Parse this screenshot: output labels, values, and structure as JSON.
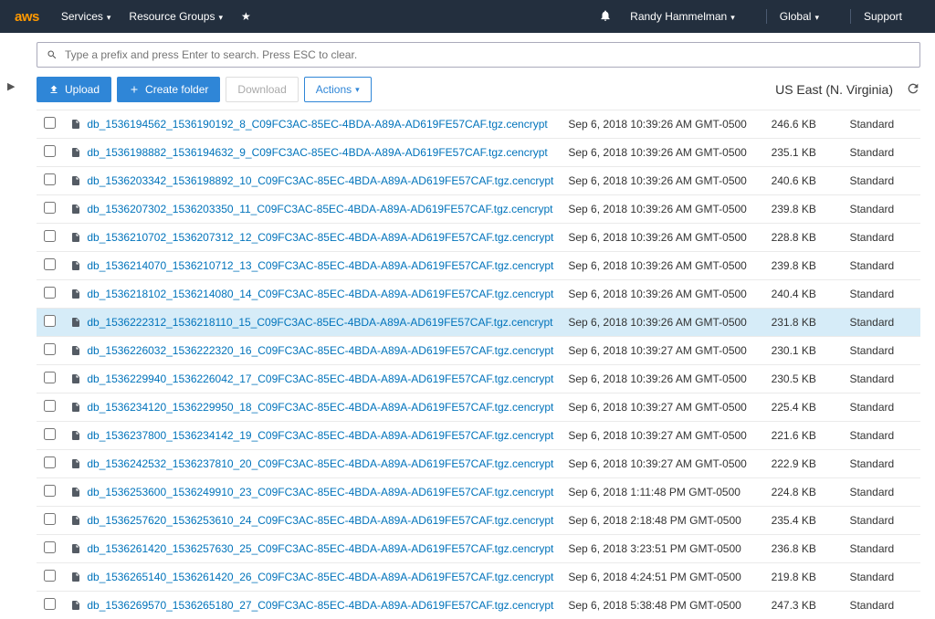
{
  "header": {
    "logo": "aws",
    "services": "Services",
    "resource_groups": "Resource Groups",
    "user": "Randy Hammelman",
    "global": "Global",
    "support": "Support"
  },
  "search": {
    "placeholder": "Type a prefix and press Enter to search. Press ESC to clear."
  },
  "toolbar": {
    "upload": "Upload",
    "create_folder": "Create folder",
    "download": "Download",
    "actions": "Actions"
  },
  "region": "US East (N. Virginia)",
  "storage_class": "Standard",
  "files": [
    {
      "name": "db_1536194562_1536190192_8_C09FC3AC-85EC-4BDA-A89A-AD619FE57CAF.tgz.cencrypt",
      "modified": "Sep 6, 2018 10:39:26 AM GMT-0500",
      "size": "246.6 KB"
    },
    {
      "name": "db_1536198882_1536194632_9_C09FC3AC-85EC-4BDA-A89A-AD619FE57CAF.tgz.cencrypt",
      "modified": "Sep 6, 2018 10:39:26 AM GMT-0500",
      "size": "235.1 KB"
    },
    {
      "name": "db_1536203342_1536198892_10_C09FC3AC-85EC-4BDA-A89A-AD619FE57CAF.tgz.cencrypt",
      "modified": "Sep 6, 2018 10:39:26 AM GMT-0500",
      "size": "240.6 KB"
    },
    {
      "name": "db_1536207302_1536203350_11_C09FC3AC-85EC-4BDA-A89A-AD619FE57CAF.tgz.cencrypt",
      "modified": "Sep 6, 2018 10:39:26 AM GMT-0500",
      "size": "239.8 KB"
    },
    {
      "name": "db_1536210702_1536207312_12_C09FC3AC-85EC-4BDA-A89A-AD619FE57CAF.tgz.cencrypt",
      "modified": "Sep 6, 2018 10:39:26 AM GMT-0500",
      "size": "228.8 KB"
    },
    {
      "name": "db_1536214070_1536210712_13_C09FC3AC-85EC-4BDA-A89A-AD619FE57CAF.tgz.cencrypt",
      "modified": "Sep 6, 2018 10:39:26 AM GMT-0500",
      "size": "239.8 KB"
    },
    {
      "name": "db_1536218102_1536214080_14_C09FC3AC-85EC-4BDA-A89A-AD619FE57CAF.tgz.cencrypt",
      "modified": "Sep 6, 2018 10:39:26 AM GMT-0500",
      "size": "240.4 KB"
    },
    {
      "name": "db_1536222312_1536218110_15_C09FC3AC-85EC-4BDA-A89A-AD619FE57CAF.tgz.cencrypt",
      "modified": "Sep 6, 2018 10:39:26 AM GMT-0500",
      "size": "231.8 KB",
      "selected": true
    },
    {
      "name": "db_1536226032_1536222320_16_C09FC3AC-85EC-4BDA-A89A-AD619FE57CAF.tgz.cencrypt",
      "modified": "Sep 6, 2018 10:39:27 AM GMT-0500",
      "size": "230.1 KB"
    },
    {
      "name": "db_1536229940_1536226042_17_C09FC3AC-85EC-4BDA-A89A-AD619FE57CAF.tgz.cencrypt",
      "modified": "Sep 6, 2018 10:39:26 AM GMT-0500",
      "size": "230.5 KB"
    },
    {
      "name": "db_1536234120_1536229950_18_C09FC3AC-85EC-4BDA-A89A-AD619FE57CAF.tgz.cencrypt",
      "modified": "Sep 6, 2018 10:39:27 AM GMT-0500",
      "size": "225.4 KB"
    },
    {
      "name": "db_1536237800_1536234142_19_C09FC3AC-85EC-4BDA-A89A-AD619FE57CAF.tgz.cencrypt",
      "modified": "Sep 6, 2018 10:39:27 AM GMT-0500",
      "size": "221.6 KB"
    },
    {
      "name": "db_1536242532_1536237810_20_C09FC3AC-85EC-4BDA-A89A-AD619FE57CAF.tgz.cencrypt",
      "modified": "Sep 6, 2018 10:39:27 AM GMT-0500",
      "size": "222.9 KB"
    },
    {
      "name": "db_1536253600_1536249910_23_C09FC3AC-85EC-4BDA-A89A-AD619FE57CAF.tgz.cencrypt",
      "modified": "Sep 6, 2018 1:11:48 PM GMT-0500",
      "size": "224.8 KB"
    },
    {
      "name": "db_1536257620_1536253610_24_C09FC3AC-85EC-4BDA-A89A-AD619FE57CAF.tgz.cencrypt",
      "modified": "Sep 6, 2018 2:18:48 PM GMT-0500",
      "size": "235.4 KB"
    },
    {
      "name": "db_1536261420_1536257630_25_C09FC3AC-85EC-4BDA-A89A-AD619FE57CAF.tgz.cencrypt",
      "modified": "Sep 6, 2018 3:23:51 PM GMT-0500",
      "size": "236.8 KB"
    },
    {
      "name": "db_1536265140_1536261420_26_C09FC3AC-85EC-4BDA-A89A-AD619FE57CAF.tgz.cencrypt",
      "modified": "Sep 6, 2018 4:24:51 PM GMT-0500",
      "size": "219.8 KB"
    },
    {
      "name": "db_1536269570_1536265180_27_C09FC3AC-85EC-4BDA-A89A-AD619FE57CAF.tgz.cencrypt",
      "modified": "Sep 6, 2018 5:38:48 PM GMT-0500",
      "size": "247.3 KB"
    }
  ]
}
